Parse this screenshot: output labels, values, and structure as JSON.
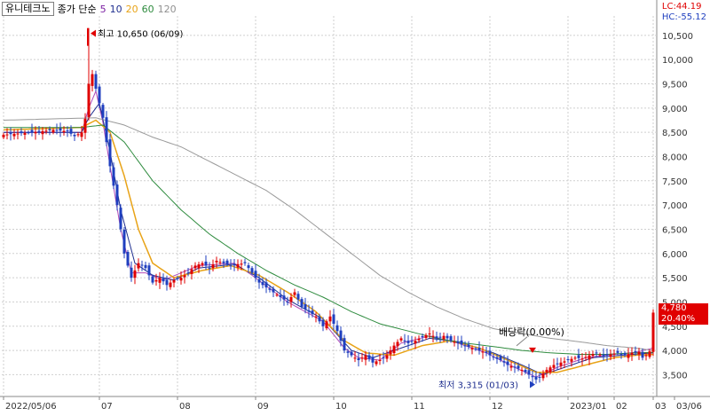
{
  "header": {
    "stock_name": "유니테크노",
    "ma_label": "종가 단순",
    "ma_periods": [
      {
        "label": "5",
        "color": "#7b1fa2"
      },
      {
        "label": "10",
        "color": "#1f2f8f"
      },
      {
        "label": "20",
        "color": "#e8a317"
      },
      {
        "label": "60",
        "color": "#2e8b3e"
      },
      {
        "label": "120",
        "color": "#909090"
      }
    ]
  },
  "indicators": {
    "lc": "LC:44.19",
    "hc": "HC:-55.12"
  },
  "price_tag": {
    "price": "4,780",
    "change": "20.40%"
  },
  "annotations": {
    "high": "최고 10,650 (06/09)",
    "low": "최저 3,315 (01/03)",
    "dividend": "배당락(0.00%)"
  },
  "colors": {
    "up": "#e00000",
    "down": "#1f3fbf",
    "grid": "#cfcfcf",
    "price_bg": "#e00000"
  },
  "chart_data": {
    "type": "candlestick",
    "x_ticks": [
      "2022/05/06",
      "07",
      "08",
      "09",
      "10",
      "11",
      "12",
      "2023/01",
      "02",
      "03",
      "03/06"
    ],
    "y_ticks": [
      3500,
      4000,
      4500,
      5000,
      5500,
      6000,
      6500,
      7000,
      7500,
      8000,
      8500,
      9000,
      9500,
      10000,
      10500
    ],
    "ylim": [
      3050,
      10900
    ],
    "last_price": 4780,
    "change_pct": 20.4,
    "high": {
      "value": 10650,
      "date": "06/09"
    },
    "low": {
      "value": 3315,
      "date": "01/03"
    },
    "close_path": [
      [
        0,
        8450
      ],
      [
        8,
        8500
      ],
      [
        14,
        8550
      ],
      [
        18,
        8520
      ],
      [
        20,
        8420
      ],
      [
        22,
        8500
      ],
      [
        23,
        8780
      ],
      [
        24,
        9500
      ],
      [
        25,
        9700
      ],
      [
        26,
        9400
      ],
      [
        27,
        9100
      ],
      [
        28,
        8800
      ],
      [
        30,
        7800
      ],
      [
        32,
        7000
      ],
      [
        34,
        6000
      ],
      [
        36,
        5500
      ],
      [
        38,
        5800
      ],
      [
        40,
        5700
      ],
      [
        42,
        5400
      ],
      [
        44,
        5500
      ],
      [
        46,
        5350
      ],
      [
        48,
        5450
      ],
      [
        50,
        5500
      ],
      [
        52,
        5600
      ],
      [
        54,
        5750
      ],
      [
        56,
        5800
      ],
      [
        58,
        5700
      ],
      [
        60,
        5850
      ],
      [
        62,
        5800
      ],
      [
        64,
        5750
      ],
      [
        66,
        5780
      ],
      [
        68,
        5800
      ],
      [
        70,
        5600
      ],
      [
        72,
        5400
      ],
      [
        74,
        5300
      ],
      [
        76,
        5200
      ],
      [
        78,
        5100
      ],
      [
        80,
        5000
      ],
      [
        82,
        5200
      ],
      [
        84,
        4900
      ],
      [
        86,
        4800
      ],
      [
        88,
        4700
      ],
      [
        90,
        4500
      ],
      [
        92,
        4700
      ],
      [
        94,
        4400
      ],
      [
        96,
        4000
      ],
      [
        98,
        3900
      ],
      [
        100,
        3800
      ],
      [
        102,
        3900
      ],
      [
        104,
        3750
      ],
      [
        106,
        3800
      ],
      [
        108,
        3900
      ],
      [
        110,
        4100
      ],
      [
        112,
        4250
      ],
      [
        114,
        4150
      ],
      [
        116,
        4200
      ],
      [
        118,
        4280
      ],
      [
        120,
        4350
      ],
      [
        122,
        4250
      ],
      [
        124,
        4300
      ],
      [
        126,
        4200
      ],
      [
        128,
        4150
      ],
      [
        130,
        4100
      ],
      [
        132,
        4050
      ],
      [
        134,
        4000
      ],
      [
        136,
        3950
      ],
      [
        138,
        3850
      ],
      [
        140,
        3800
      ],
      [
        142,
        3700
      ],
      [
        144,
        3650
      ],
      [
        146,
        3600
      ],
      [
        148,
        3500
      ],
      [
        150,
        3400
      ],
      [
        151,
        3450
      ],
      [
        153,
        3600
      ],
      [
        155,
        3700
      ],
      [
        157,
        3750
      ],
      [
        159,
        3800
      ],
      [
        161,
        3850
      ],
      [
        163,
        3830
      ],
      [
        165,
        3900
      ],
      [
        167,
        3950
      ],
      [
        169,
        3880
      ],
      [
        171,
        3920
      ],
      [
        173,
        3950
      ],
      [
        175,
        3900
      ],
      [
        177,
        3950
      ],
      [
        179,
        3970
      ],
      [
        180,
        3850
      ],
      [
        181,
        3900
      ],
      [
        182,
        3980
      ],
      [
        183,
        4780
      ]
    ],
    "ma_paths": {
      "ma5": [
        [
          0,
          8500
        ],
        [
          22,
          8500
        ],
        [
          24,
          9000
        ],
        [
          26,
          9350
        ],
        [
          28,
          8700
        ],
        [
          30,
          7800
        ],
        [
          33,
          6500
        ],
        [
          36,
          5600
        ],
        [
          40,
          5600
        ],
        [
          45,
          5450
        ],
        [
          55,
          5750
        ],
        [
          65,
          5800
        ],
        [
          70,
          5550
        ],
        [
          80,
          5000
        ],
        [
          90,
          4600
        ],
        [
          96,
          4050
        ],
        [
          100,
          3850
        ],
        [
          106,
          3800
        ],
        [
          112,
          4150
        ],
        [
          120,
          4300
        ],
        [
          128,
          4150
        ],
        [
          136,
          3950
        ],
        [
          144,
          3650
        ],
        [
          150,
          3450
        ],
        [
          156,
          3650
        ],
        [
          164,
          3850
        ],
        [
          172,
          3920
        ],
        [
          178,
          3960
        ],
        [
          183,
          4050
        ]
      ],
      "ma10": [
        [
          0,
          8500
        ],
        [
          22,
          8500
        ],
        [
          24,
          8800
        ],
        [
          27,
          9100
        ],
        [
          30,
          8100
        ],
        [
          33,
          6900
        ],
        [
          37,
          5800
        ],
        [
          42,
          5550
        ],
        [
          48,
          5450
        ],
        [
          55,
          5700
        ],
        [
          65,
          5780
        ],
        [
          72,
          5500
        ],
        [
          80,
          5050
        ],
        [
          90,
          4650
        ],
        [
          98,
          4000
        ],
        [
          104,
          3850
        ],
        [
          112,
          4050
        ],
        [
          120,
          4250
        ],
        [
          128,
          4180
        ],
        [
          138,
          3950
        ],
        [
          146,
          3700
        ],
        [
          152,
          3500
        ],
        [
          158,
          3650
        ],
        [
          166,
          3850
        ],
        [
          174,
          3900
        ],
        [
          183,
          3950
        ]
      ],
      "ma20": [
        [
          0,
          8550
        ],
        [
          22,
          8600
        ],
        [
          26,
          8750
        ],
        [
          30,
          8500
        ],
        [
          34,
          7600
        ],
        [
          38,
          6500
        ],
        [
          42,
          5800
        ],
        [
          48,
          5500
        ],
        [
          56,
          5650
        ],
        [
          64,
          5750
        ],
        [
          72,
          5550
        ],
        [
          80,
          5200
        ],
        [
          88,
          4800
        ],
        [
          96,
          4200
        ],
        [
          102,
          3950
        ],
        [
          110,
          3900
        ],
        [
          118,
          4100
        ],
        [
          126,
          4200
        ],
        [
          134,
          4050
        ],
        [
          142,
          3800
        ],
        [
          150,
          3550
        ],
        [
          156,
          3550
        ],
        [
          164,
          3700
        ],
        [
          172,
          3850
        ],
        [
          178,
          3900
        ],
        [
          183,
          3920
        ]
      ],
      "ma60": [
        [
          0,
          8600
        ],
        [
          22,
          8600
        ],
        [
          28,
          8650
        ],
        [
          34,
          8300
        ],
        [
          42,
          7500
        ],
        [
          50,
          6900
        ],
        [
          58,
          6400
        ],
        [
          66,
          6000
        ],
        [
          74,
          5650
        ],
        [
          82,
          5350
        ],
        [
          90,
          5100
        ],
        [
          98,
          4800
        ],
        [
          106,
          4550
        ],
        [
          114,
          4400
        ],
        [
          122,
          4250
        ],
        [
          130,
          4150
        ],
        [
          138,
          4080
        ],
        [
          146,
          4000
        ],
        [
          154,
          3950
        ],
        [
          162,
          3920
        ],
        [
          170,
          3920
        ],
        [
          178,
          3950
        ],
        [
          183,
          3960
        ]
      ],
      "ma120": [
        [
          0,
          8750
        ],
        [
          26,
          8800
        ],
        [
          34,
          8650
        ],
        [
          42,
          8400
        ],
        [
          50,
          8200
        ],
        [
          58,
          7900
        ],
        [
          66,
          7600
        ],
        [
          74,
          7300
        ],
        [
          82,
          6900
        ],
        [
          90,
          6450
        ],
        [
          98,
          6000
        ],
        [
          106,
          5550
        ],
        [
          114,
          5200
        ],
        [
          122,
          4900
        ],
        [
          130,
          4650
        ],
        [
          138,
          4450
        ],
        [
          146,
          4350
        ],
        [
          154,
          4250
        ],
        [
          162,
          4180
        ],
        [
          170,
          4100
        ],
        [
          178,
          4050
        ],
        [
          183,
          4000
        ]
      ]
    }
  }
}
